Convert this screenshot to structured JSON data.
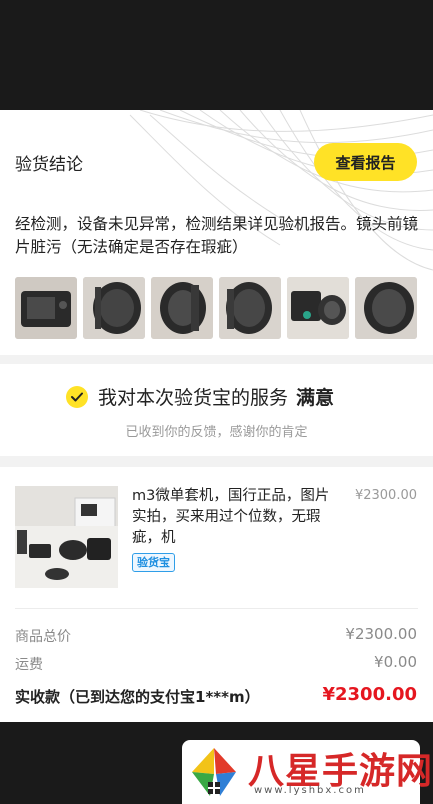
{
  "inspection": {
    "title": "验货结论",
    "report_button": "查看报告",
    "conclusion": "经检测，设备未见异常，检测结果详见验机报告。镜头前镜片脏污（无法确定是否存在瑕疵）",
    "photos": [
      "photo-1",
      "photo-2",
      "photo-3",
      "photo-4",
      "photo-5",
      "photo-6"
    ]
  },
  "satisfaction": {
    "text": "我对本次验货宝的服务",
    "highlight": "满意",
    "sub": "已收到你的反馈，感谢你的肯定"
  },
  "product": {
    "title": "m3微单套机，国行正品，图片实拍，买来用过个位数，无瑕疵，机",
    "price": "¥2300.00",
    "badge": "验货宝"
  },
  "summary": {
    "goods_total_label": "商品总价",
    "goods_total_value": "¥2300.00",
    "shipping_label": "运费",
    "shipping_value": "¥0.00",
    "received_label": "实收款（已到达您的支付宝1***m）",
    "received_value": "¥2300.00"
  },
  "watermark": {
    "text": "八星手游网",
    "url": "www.lyshbx.com"
  },
  "colors": {
    "accent_yellow": "#ffe226",
    "price_red": "#e5161f",
    "badge_blue": "#1e8fe0"
  }
}
